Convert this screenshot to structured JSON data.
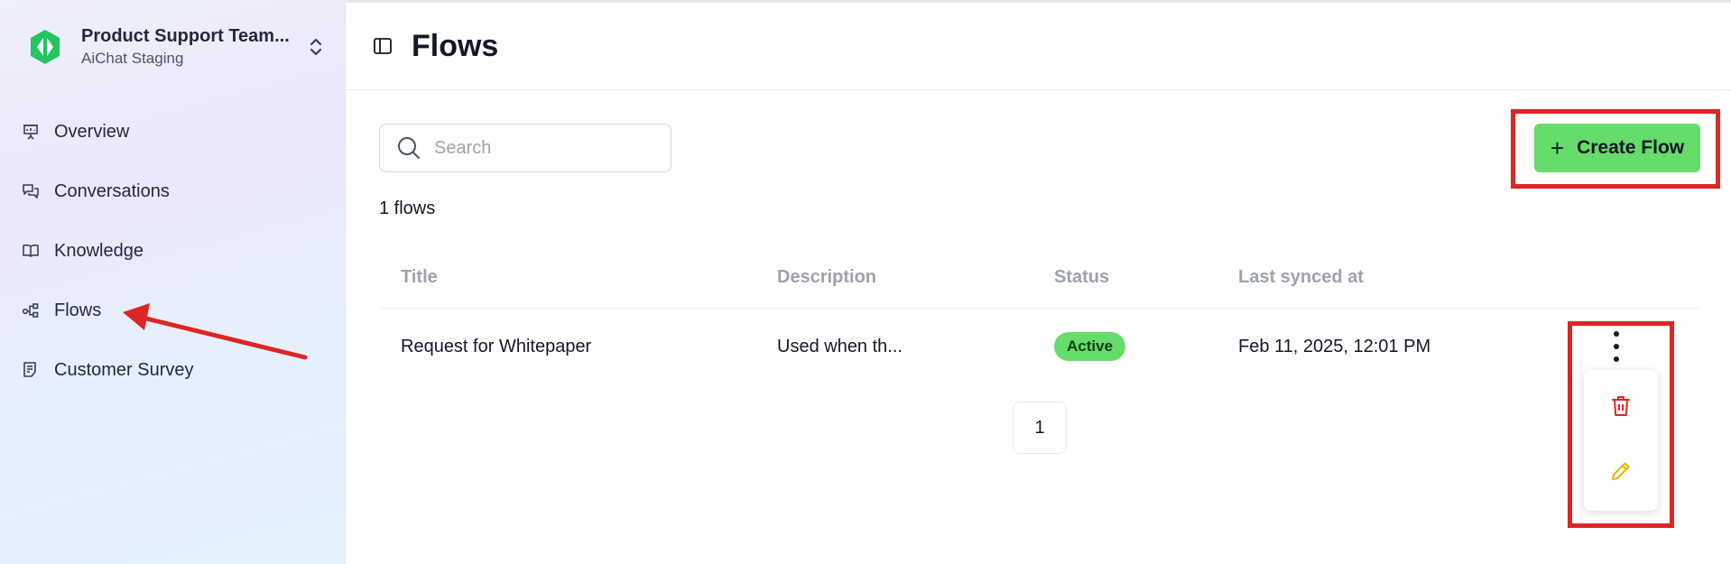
{
  "brand": {
    "title": "Product Support Team...",
    "subtitle": "AiChat Staging",
    "accent": "#22c55e"
  },
  "nav": [
    {
      "label": "Overview",
      "icon": "presentation-icon"
    },
    {
      "label": "Conversations",
      "icon": "chat-bubbles-icon"
    },
    {
      "label": "Knowledge",
      "icon": "book-icon"
    },
    {
      "label": "Flows",
      "icon": "flow-icon"
    },
    {
      "label": "Customer Survey",
      "icon": "survey-icon"
    }
  ],
  "header": {
    "title": "Flows"
  },
  "search": {
    "placeholder": "Search",
    "value": ""
  },
  "actions": {
    "create_label": "Create Flow",
    "create_color": "#66dc6a"
  },
  "count_text": "1 flows",
  "table": {
    "columns": [
      "Title",
      "Description",
      "Status",
      "Last synced at"
    ],
    "rows": [
      {
        "title": "Request for Whitepaper",
        "description": "Used when th...",
        "status": "Active",
        "last_synced": "Feb 11, 2025, 12:01 PM"
      }
    ]
  },
  "row_menu": [
    {
      "action": "delete",
      "icon": "trash-icon",
      "color": "#dc2626"
    },
    {
      "action": "edit",
      "icon": "pencil-icon",
      "color": "#eab308"
    }
  ],
  "pagination": {
    "current_page": "1"
  },
  "annotation_color": "#dc2626"
}
